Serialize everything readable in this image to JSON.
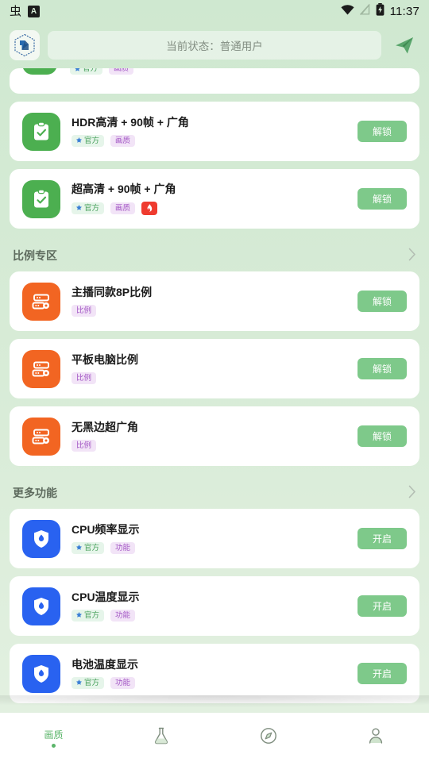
{
  "statusbar": {
    "left_icons": [
      "bug-glyph-icon",
      "boxed-a-icon"
    ],
    "left_glyph": "虫",
    "boxed_a": "A",
    "right_icons": [
      "wifi-icon",
      "signal-off-icon",
      "battery-charging-icon"
    ],
    "time": "11:37"
  },
  "header": {
    "logo_icon": "app-hexagon-logo",
    "search_placeholder": "当前状态：普通用户",
    "send_icon": "send-plane-icon"
  },
  "colors": {
    "green_icon": "#4caf50",
    "orange_icon": "#f26522",
    "blue_icon": "#2962f0",
    "button_green": "#7ec98a",
    "badge_official_bg": "#e6f5ea",
    "badge_official_text": "#46a05a",
    "badge_purple_bg": "#f2e4f7",
    "badge_purple_text": "#a255c4",
    "badge_fire_bg": "#ef3b2f",
    "header_gradient_top": "#cfe8d0",
    "active_nav": "#5bb56a"
  },
  "labels": {
    "official": "官方",
    "quality": "画质",
    "ratio": "比例",
    "feature": "功能",
    "unlock": "解锁",
    "enable": "开启"
  },
  "partial_item": {
    "badges": [
      {
        "text": "官方",
        "style": "official"
      },
      {
        "text": "画质",
        "style": "purple"
      }
    ]
  },
  "quality_items": [
    {
      "title": "HDR高清 + 90帧 + 广角",
      "icon": "clipboard-check-icon",
      "icon_color": "green",
      "badges": [
        {
          "text": "官方",
          "style": "official"
        },
        {
          "text": "画质",
          "style": "purple"
        }
      ],
      "action": "解锁"
    },
    {
      "title": "超高清 + 90帧 + 广角",
      "icon": "clipboard-check-icon",
      "icon_color": "green",
      "badges": [
        {
          "text": "官方",
          "style": "official"
        },
        {
          "text": "画质",
          "style": "purple"
        },
        {
          "text": "",
          "style": "fire"
        }
      ],
      "action": "解锁"
    }
  ],
  "sections": [
    {
      "title": "比例专区",
      "chevron": "chevron-right-icon",
      "items": [
        {
          "title": "主播同款8P比例",
          "icon": "server-ratio-icon",
          "icon_color": "orange",
          "badges": [
            {
              "text": "比例",
              "style": "purple"
            }
          ],
          "action": "解锁"
        },
        {
          "title": "平板电脑比例",
          "icon": "server-ratio-icon",
          "icon_color": "orange",
          "badges": [
            {
              "text": "比例",
              "style": "purple"
            }
          ],
          "action": "解锁"
        },
        {
          "title": "无黑边超广角",
          "icon": "server-ratio-icon",
          "icon_color": "orange",
          "badges": [
            {
              "text": "比例",
              "style": "purple"
            }
          ],
          "action": "解锁"
        }
      ]
    },
    {
      "title": "更多功能",
      "chevron": "chevron-right-icon",
      "items": [
        {
          "title": "CPU频率显示",
          "icon": "shield-drop-icon",
          "icon_color": "blue",
          "badges": [
            {
              "text": "官方",
              "style": "official"
            },
            {
              "text": "功能",
              "style": "purple"
            }
          ],
          "action": "开启"
        },
        {
          "title": "CPU温度显示",
          "icon": "shield-drop-icon",
          "icon_color": "blue",
          "badges": [
            {
              "text": "官方",
              "style": "official"
            },
            {
              "text": "功能",
              "style": "purple"
            }
          ],
          "action": "开启"
        },
        {
          "title": "电池温度显示",
          "icon": "shield-drop-icon",
          "icon_color": "blue",
          "badges": [
            {
              "text": "官方",
              "style": "official"
            },
            {
              "text": "功能",
              "style": "purple"
            }
          ],
          "action": "开启"
        }
      ]
    }
  ],
  "bottomnav": [
    {
      "label": "画质",
      "icon": "quality-text-icon",
      "active": true
    },
    {
      "label": "",
      "icon": "flask-icon",
      "active": false
    },
    {
      "label": "",
      "icon": "compass-icon",
      "active": false
    },
    {
      "label": "",
      "icon": "person-icon",
      "active": false
    }
  ]
}
